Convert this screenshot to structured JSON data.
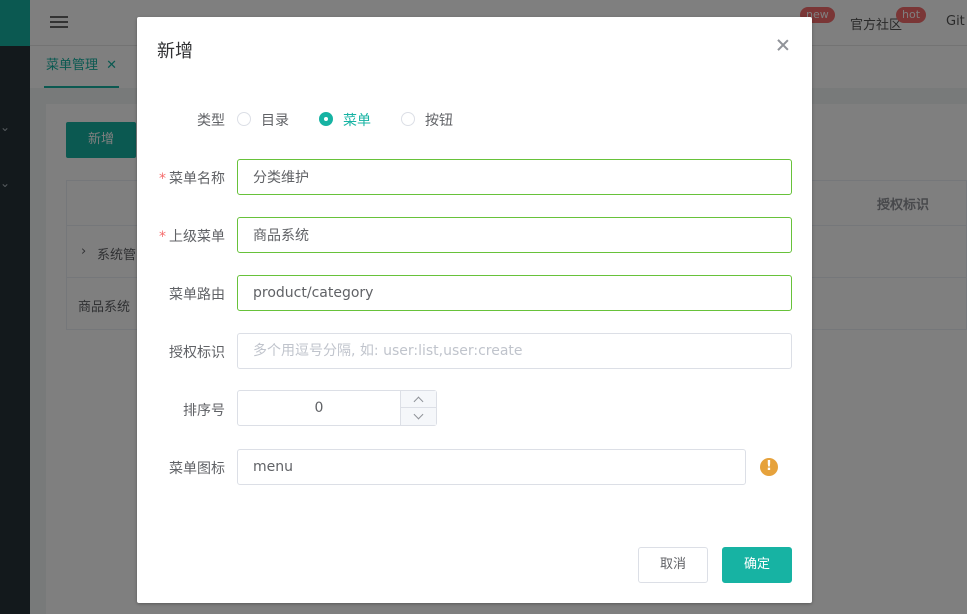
{
  "header": {
    "new_badge": "new",
    "community": "官方社区",
    "hot_badge": "hot",
    "git": "Git"
  },
  "tabs": [
    {
      "label": "菜单管理"
    }
  ],
  "background": {
    "add_button": "新增",
    "table_header_auth": "授权标识",
    "row1": "系统管",
    "row2": "商品系统"
  },
  "dialog": {
    "title": "新增",
    "type_label": "类型",
    "type_options": [
      {
        "label": "目录",
        "checked": false
      },
      {
        "label": "菜单",
        "checked": true
      },
      {
        "label": "按钮",
        "checked": false
      }
    ],
    "name_label": "菜单名称",
    "name_value": "分类维护",
    "parent_label": "上级菜单",
    "parent_value": "商品系统",
    "route_label": "菜单路由",
    "route_value": "product/category",
    "perms_label": "授权标识",
    "perms_placeholder": "多个用逗号分隔, 如: user:list,user:create",
    "order_label": "排序号",
    "order_value": "0",
    "icon_label": "菜单图标",
    "icon_value": "menu",
    "required_mark": "*",
    "cancel": "取消",
    "confirm": "确定"
  },
  "colors": {
    "primary": "#17b3a3",
    "valid_border": "#67c23a",
    "warning": "#e6a23c",
    "badge": "#f56c6c",
    "sidebar": "#263238"
  }
}
